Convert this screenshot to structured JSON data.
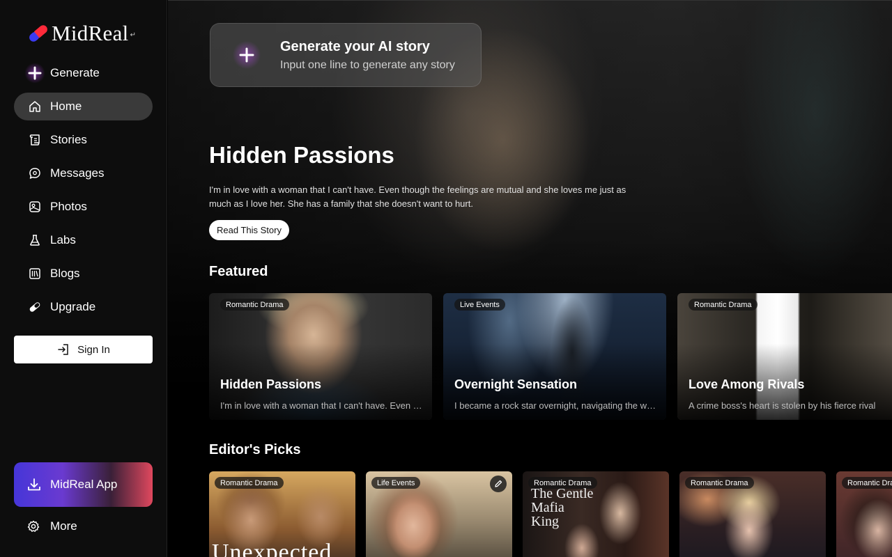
{
  "brand": {
    "name": "MidReal",
    "sup": "↵"
  },
  "sidebar": {
    "items": [
      {
        "label": "Generate",
        "icon": "plus-sparkle-icon"
      },
      {
        "label": "Home",
        "icon": "home-icon",
        "active": true
      },
      {
        "label": "Stories",
        "icon": "scroll-icon"
      },
      {
        "label": "Messages",
        "icon": "chat-icon"
      },
      {
        "label": "Photos",
        "icon": "photo-icon"
      },
      {
        "label": "Labs",
        "icon": "flask-icon"
      },
      {
        "label": "Blogs",
        "icon": "books-icon"
      },
      {
        "label": "Upgrade",
        "icon": "pill-icon"
      }
    ],
    "signin_label": "Sign In",
    "app_label": "MidReal App",
    "more_label": "More"
  },
  "generate_card": {
    "title": "Generate your AI story",
    "subtitle": "Input one line to generate any story"
  },
  "hero": {
    "title": "Hidden Passions",
    "description": "I'm in love with a woman that I can't have. Even though the feelings are mutual and she loves me just as much as I love her. She has a family that she doesn't want to hurt.",
    "button_label": "Read This Story"
  },
  "featured": {
    "heading": "Featured",
    "cards": [
      {
        "tag": "Romantic Drama",
        "title": "Hidden Passions",
        "desc": "I'm in love with a woman that I can't have. Even though the feelings are mutual"
      },
      {
        "tag": "Live Events",
        "title": "Overnight Sensation",
        "desc": "I became a rock star overnight, navigating the world of fame"
      },
      {
        "tag": "Romantic Drama",
        "title": "Love Among Rivals",
        "desc": "A crime boss's heart is stolen by his fierce rival"
      }
    ]
  },
  "editors_picks": {
    "heading": "Editor's Picks",
    "cards": [
      {
        "tag": "Romantic Drama",
        "cover_text": "Unexpected"
      },
      {
        "tag": "Life Events",
        "cover_text": ""
      },
      {
        "tag": "Romantic Drama",
        "cover_text": "The Gentle Mafia King"
      },
      {
        "tag": "Romantic Drama",
        "cover_text": ""
      },
      {
        "tag": "Romantic Dra",
        "cover_text": ""
      }
    ]
  },
  "colors": {
    "accent": "#c446ff",
    "active_nav": "#3a3a3a",
    "sidebar_bg": "#0d0d0d"
  }
}
